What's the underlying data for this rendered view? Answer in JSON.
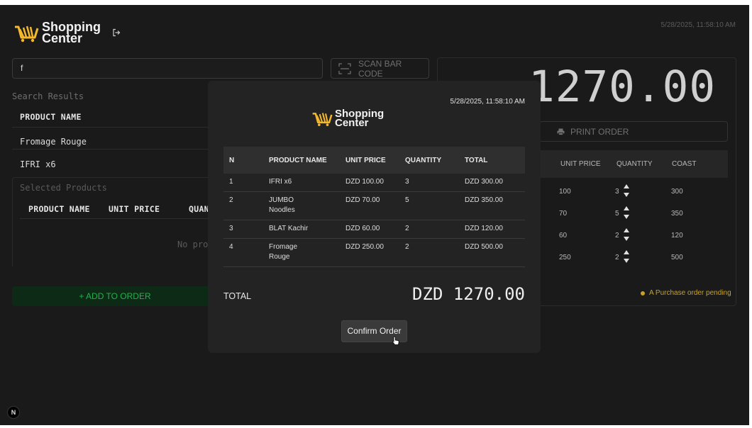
{
  "header": {
    "brand_line1": "Shopping",
    "brand_line2": "Center",
    "datetime": "5/28/2025, 11:58:10 AM"
  },
  "search": {
    "value": "f"
  },
  "scan": {
    "label": "SCAN BAR CODE"
  },
  "results": {
    "label": "Search Results",
    "header": "PRODUCT NAME",
    "items": [
      "Fromage Rouge",
      "IFRI x6"
    ]
  },
  "selected": {
    "label": "Selected Products",
    "headers": [
      "PRODUCT NAME",
      "UNIT PRICE",
      "QUAN"
    ],
    "empty": "No proc"
  },
  "add_button": "+ ADD TO ORDER",
  "order_panel": {
    "total": "1270.00",
    "print_label": "PRINT ORDER",
    "headers": [
      "UNIT PRICE",
      "QUANTITY",
      "COAST"
    ],
    "rows": [
      {
        "unit": "100",
        "qty": "3",
        "cost": "300"
      },
      {
        "unit": "70",
        "qty": "5",
        "cost": "350"
      },
      {
        "unit": "60",
        "qty": "2",
        "cost": "120"
      },
      {
        "unit": "250",
        "qty": "2",
        "cost": "500"
      }
    ],
    "pending": "A Purchase order pending"
  },
  "badge": "N",
  "modal": {
    "datetime": "5/28/2025, 11:58:10 AM",
    "brand_line1": "Shopping",
    "brand_line2": "Center",
    "headers": [
      "N",
      "PRODUCT NAME",
      "UNIT PRICE",
      "QUANTITY",
      "TOTAL"
    ],
    "rows": [
      {
        "n": "1",
        "name": "IFRI x6",
        "unit": "DZD 100.00",
        "qty": "3",
        "total": "DZD 300.00"
      },
      {
        "n": "2",
        "name": "JUMBO Noodles",
        "unit": "DZD 70.00",
        "qty": "5",
        "total": "DZD 350.00"
      },
      {
        "n": "3",
        "name": "BLAT Kachir",
        "unit": "DZD 60.00",
        "qty": "2",
        "total": "DZD 120.00"
      },
      {
        "n": "4",
        "name": "Fromage Rouge",
        "unit": "DZD 250.00",
        "qty": "2",
        "total": "DZD 500.00"
      }
    ],
    "total_label": "TOTAL",
    "total_value": "DZD 1270.00",
    "confirm_label": "Confirm Order"
  },
  "colors": {
    "background": "#1a1a1a",
    "modal": "#232323",
    "accent_green": "#22b14c",
    "pending_yellow": "#c9a227",
    "logo_yellow": "#f5b72b"
  },
  "icons": [
    "shopping-cart-icon",
    "logout-icon",
    "barcode-scan-icon",
    "printer-icon",
    "arrow-up-icon",
    "arrow-down-icon",
    "pointer-cursor-icon"
  ]
}
